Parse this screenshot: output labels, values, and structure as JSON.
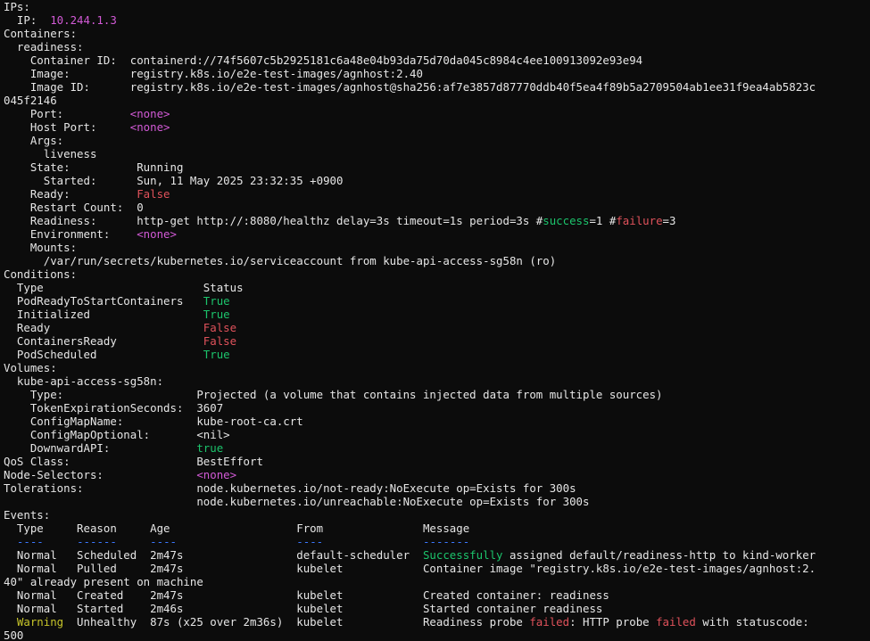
{
  "colors": {
    "background": "#0c0c0c",
    "foreground": "#e6e6e6",
    "magenta": "#d25ad6",
    "red": "#e0525b",
    "green": "#1cc46c",
    "yellow": "#c7c52a",
    "blue": "#3b78ff"
  },
  "lines": [
    [
      {
        "t": "IPs:"
      }
    ],
    [
      {
        "t": "  IP:  "
      },
      {
        "t": "10.244.1.3",
        "c": "magenta"
      }
    ],
    [
      {
        "t": "Containers:"
      }
    ],
    [
      {
        "t": "  readiness:"
      }
    ],
    [
      {
        "t": "    Container ID:  containerd://74f5607c5b2925181c6a48e04b93da75d70da045c8984c4ee100913092e93e94"
      }
    ],
    [
      {
        "t": "    Image:         registry.k8s.io/e2e-test-images/agnhost:2.40"
      }
    ],
    [
      {
        "t": "    Image ID:      registry.k8s.io/e2e-test-images/agnhost@sha256:af7e3857d87770ddb40f5ea4f89b5a2709504ab1ee31f9ea4ab5823c"
      }
    ],
    [
      {
        "t": "045f2146"
      }
    ],
    [
      {
        "t": "    Port:          "
      },
      {
        "t": "<none>",
        "c": "magenta"
      }
    ],
    [
      {
        "t": "    Host Port:     "
      },
      {
        "t": "<none>",
        "c": "magenta"
      }
    ],
    [
      {
        "t": "    Args:"
      }
    ],
    [
      {
        "t": "      liveness"
      }
    ],
    [
      {
        "t": "    State:          Running"
      }
    ],
    [
      {
        "t": "      Started:      Sun, 11 May 2025 23:32:35 +0900"
      }
    ],
    [
      {
        "t": "    Ready:          "
      },
      {
        "t": "False",
        "c": "red"
      }
    ],
    [
      {
        "t": "    Restart Count:  0"
      }
    ],
    [
      {
        "t": "    Readiness:      http-get http://:8080/healthz delay=3s timeout=1s period=3s #"
      },
      {
        "t": "success",
        "c": "green"
      },
      {
        "t": "=1 #"
      },
      {
        "t": "failure",
        "c": "red"
      },
      {
        "t": "=3"
      }
    ],
    [
      {
        "t": "    Environment:    "
      },
      {
        "t": "<none>",
        "c": "magenta"
      }
    ],
    [
      {
        "t": "    Mounts:"
      }
    ],
    [
      {
        "t": "      /var/run/secrets/kubernetes.io/serviceaccount from kube-api-access-sg58n (ro)"
      }
    ],
    [
      {
        "t": "Conditions:"
      }
    ],
    [
      {
        "t": "  Type                        Status"
      }
    ],
    [
      {
        "t": "  PodReadyToStartContainers   "
      },
      {
        "t": "True",
        "c": "green"
      }
    ],
    [
      {
        "t": "  Initialized                 "
      },
      {
        "t": "True",
        "c": "green"
      }
    ],
    [
      {
        "t": "  Ready                       "
      },
      {
        "t": "False",
        "c": "red"
      }
    ],
    [
      {
        "t": "  ContainersReady             "
      },
      {
        "t": "False",
        "c": "red"
      }
    ],
    [
      {
        "t": "  PodScheduled                "
      },
      {
        "t": "True",
        "c": "green"
      }
    ],
    [
      {
        "t": "Volumes:"
      }
    ],
    [
      {
        "t": "  kube-api-access-sg58n:"
      }
    ],
    [
      {
        "t": "    Type:                    Projected (a volume that contains injected data from multiple sources)"
      }
    ],
    [
      {
        "t": "    TokenExpirationSeconds:  3607"
      }
    ],
    [
      {
        "t": "    ConfigMapName:           kube-root-ca.crt"
      }
    ],
    [
      {
        "t": "    ConfigMapOptional:       <nil>"
      }
    ],
    [
      {
        "t": "    DownwardAPI:             "
      },
      {
        "t": "true",
        "c": "green"
      }
    ],
    [
      {
        "t": "QoS Class:                   BestEffort"
      }
    ],
    [
      {
        "t": "Node-Selectors:              "
      },
      {
        "t": "<none>",
        "c": "magenta"
      }
    ],
    [
      {
        "t": "Tolerations:                 node.kubernetes.io/not-ready:NoExecute op=Exists for 300s"
      }
    ],
    [
      {
        "t": "                             node.kubernetes.io/unreachable:NoExecute op=Exists for 300s"
      }
    ],
    [
      {
        "t": "Events:"
      }
    ],
    [
      {
        "t": "  Type     Reason     Age                   From               Message"
      }
    ],
    [
      {
        "t": "  ",
        "c": "normal"
      },
      {
        "t": "----",
        "c": "blue"
      },
      {
        "t": "     "
      },
      {
        "t": "------",
        "c": "blue"
      },
      {
        "t": "     "
      },
      {
        "t": "----",
        "c": "blue"
      },
      {
        "t": "                  "
      },
      {
        "t": "----",
        "c": "blue"
      },
      {
        "t": "               "
      },
      {
        "t": "-------",
        "c": "blue"
      }
    ],
    [
      {
        "t": "  Normal   Scheduled  2m47s                 default-scheduler  "
      },
      {
        "t": "Successfully",
        "c": "green"
      },
      {
        "t": " assigned default/readiness-http to kind-worker"
      }
    ],
    [
      {
        "t": "  Normal   Pulled     2m47s                 kubelet            Container image \"registry.k8s.io/e2e-test-images/agnhost:2."
      }
    ],
    [
      {
        "t": "40\" already present on machine"
      }
    ],
    [
      {
        "t": "  Normal   Created    2m47s                 kubelet            Created container: readiness"
      }
    ],
    [
      {
        "t": "  Normal   Started    2m46s                 kubelet            Started container readiness"
      }
    ],
    [
      {
        "t": "  "
      },
      {
        "t": "Warning",
        "c": "yellow"
      },
      {
        "t": "  Unhealthy  87s (x25 over 2m36s)  kubelet            Readiness probe "
      },
      {
        "t": "failed",
        "c": "red"
      },
      {
        "t": ": HTTP probe "
      },
      {
        "t": "failed",
        "c": "red"
      },
      {
        "t": " with statuscode:"
      }
    ],
    [
      {
        "t": "500"
      }
    ]
  ]
}
